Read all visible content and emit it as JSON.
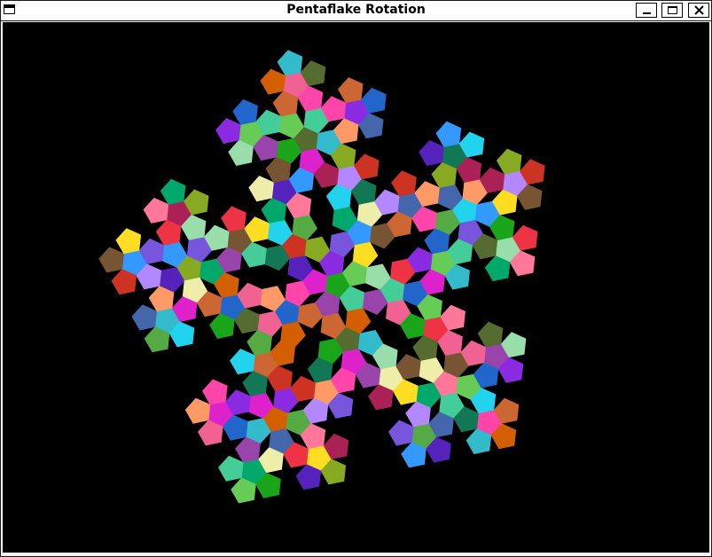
{
  "window": {
    "title": "Pentaflake Rotation",
    "icons": {
      "app": "window-menu-icon",
      "minimize": "minimize-icon",
      "maximize": "maximize-icon",
      "close": "close-icon"
    }
  },
  "canvas": {
    "background": "#000000"
  },
  "pentagon_colors": [
    "#1aa51a",
    "#ff44aa",
    "#3399ff",
    "#ee3344",
    "#8a2be2",
    "#22d3ee",
    "#ffdd22",
    "#66cc55",
    "#cc6633",
    "#7755dd",
    "#ff7799",
    "#2266cc",
    "#55aa44",
    "#aa2255",
    "#44cc99",
    "#d45f00",
    "#b388ff",
    "#00a86b",
    "#f06292",
    "#4466aa",
    "#88aa22",
    "#9944aa",
    "#33bbcc",
    "#cc3322",
    "#eeeeaa",
    "#556b2f",
    "#ff9966",
    "#5522bb",
    "#99ddaa",
    "#dd22cc",
    "#117755",
    "#775533"
  ]
}
